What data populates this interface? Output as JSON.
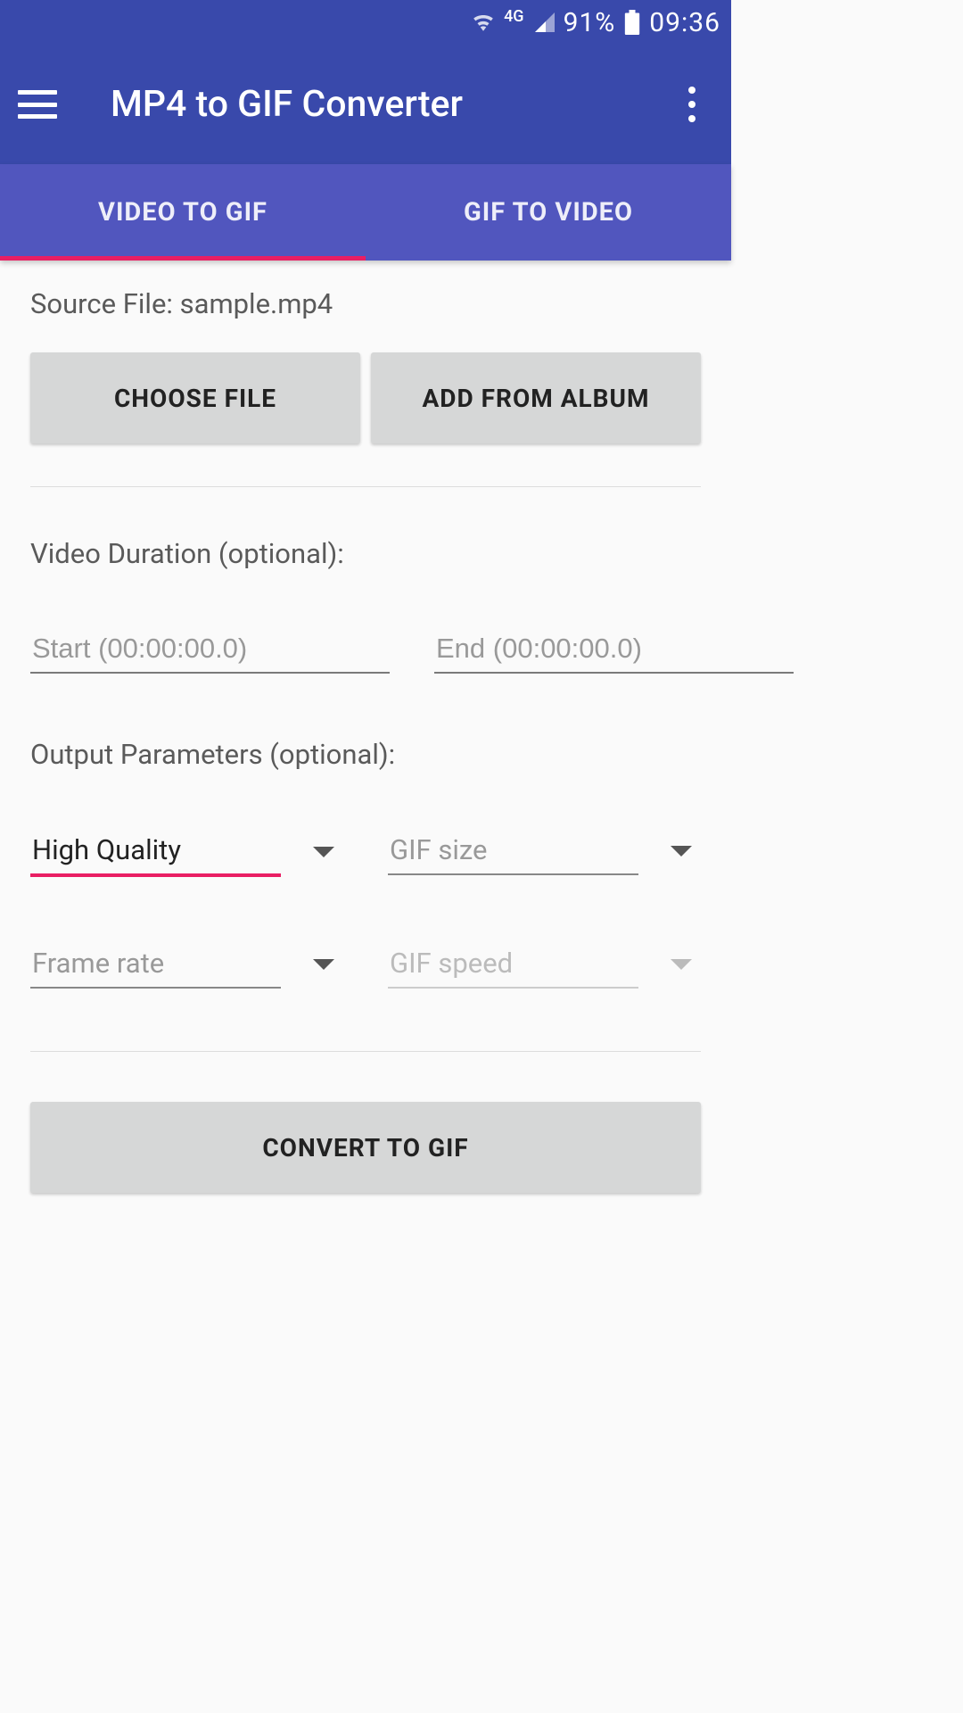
{
  "status": {
    "network": "4G",
    "battery": "91%",
    "time": "09:36"
  },
  "header": {
    "title": "MP4 to GIF Converter"
  },
  "tabs": [
    {
      "label": "VIDEO TO GIF",
      "active": true
    },
    {
      "label": "GIF TO VIDEO",
      "active": false
    }
  ],
  "source": {
    "label": "Source File: sample.mp4",
    "choose_btn": "CHOOSE FILE",
    "album_btn": "ADD FROM ALBUM"
  },
  "duration": {
    "label": "Video Duration (optional):",
    "start_placeholder": "Start (00:00:00.0)",
    "end_placeholder": "End (00:00:00.0)"
  },
  "output": {
    "label": "Output Parameters (optional):",
    "quality": {
      "value": "High Quality"
    },
    "gif_size": {
      "placeholder": "GIF size"
    },
    "frame_rate": {
      "placeholder": "Frame rate"
    },
    "gif_speed": {
      "placeholder": "GIF speed"
    }
  },
  "convert_btn": "CONVERT TO GIF"
}
